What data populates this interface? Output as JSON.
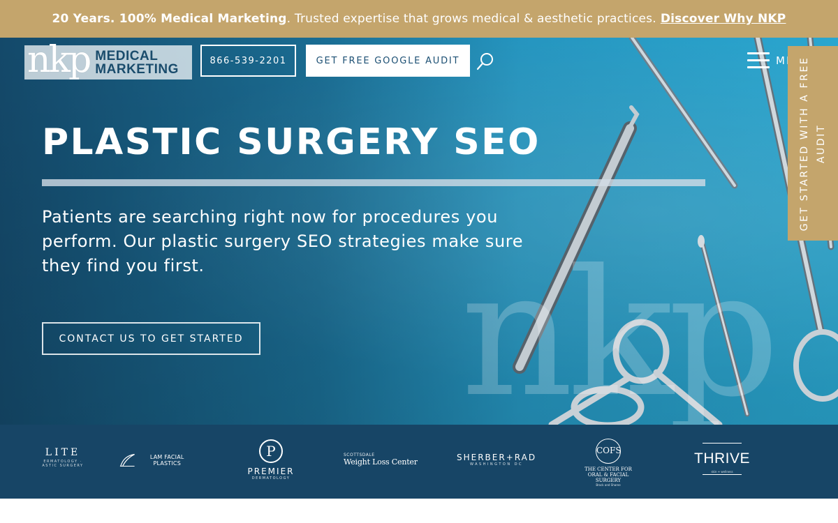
{
  "announcement": {
    "bold": "20 Years. 100% Medical Marketing",
    "text": ". Trusted expertise that grows medical & aesthetic practices.",
    "link": "Discover Why NKP"
  },
  "header": {
    "logo_mark": "nkp",
    "logo_line1": "MEDICAL",
    "logo_line2": "MARKETING",
    "phone": "866-539-2201",
    "audit_button": "GET FREE GOOGLE AUDIT",
    "menu_label": "MENU"
  },
  "side_tab": {
    "label": "GET STARTED WITH A FREE AUDIT"
  },
  "hero": {
    "title": "PLASTIC SURGERY SEO",
    "description": "Patients are searching right now for procedures you perform. Our plastic surgery SEO strategies make sure they find you first.",
    "cta": "CONTACT US TO GET STARTED",
    "watermark": "nkp"
  },
  "clients": {
    "lite": {
      "name": "LITE",
      "sub": "ERMATOLOGY · ASTIC SURGERY"
    },
    "lam": {
      "name": "LAM FACIAL PLASTICS"
    },
    "premier": {
      "mark": "P",
      "name": "PREMIER",
      "sub": "DERMATOLOGY"
    },
    "weight": {
      "sub": "SCOTTSDALE",
      "name": "Weight Loss Center"
    },
    "sherber": {
      "name": "SHERBER+RAD",
      "sub": "WASHINGTON DC"
    },
    "center": {
      "mark": "COFS",
      "name": "THE CENTER FOR ORAL & FACIAL SURGERY",
      "sub": "Brock and Sharee"
    },
    "thrive": {
      "name": "THRIVE",
      "sub": "skin + wellness"
    }
  },
  "colors": {
    "gold": "#c4a56c",
    "navy": "#174566",
    "hero_dark": "#14496a",
    "hero_light": "#2aa6cf"
  }
}
